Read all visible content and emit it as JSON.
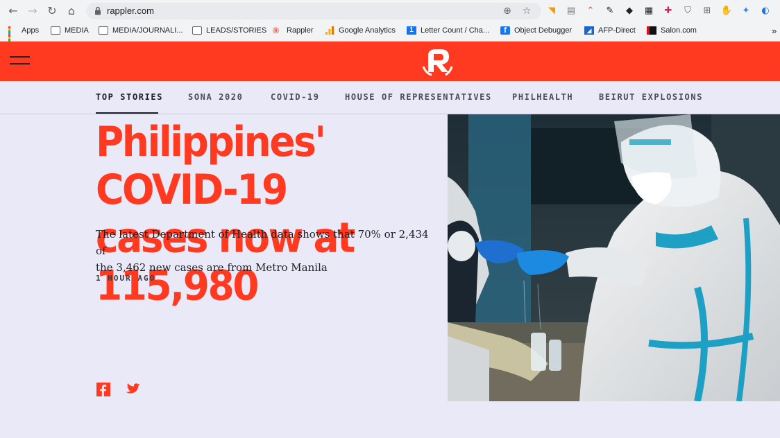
{
  "browser": {
    "url": "rappler.com",
    "bookmarks": [
      {
        "label": "Apps",
        "icon": "apps-grid-icon"
      },
      {
        "label": "MEDIA",
        "icon": "folder-icon"
      },
      {
        "label": "MEDIA/JOURNALI...",
        "icon": "folder-icon"
      },
      {
        "label": "LEADS/STORIES",
        "icon": "folder-icon"
      },
      {
        "label": "Rappler",
        "icon": "rappler-favicon-icon"
      },
      {
        "label": "Google Analytics",
        "icon": "google-analytics-icon"
      },
      {
        "label": "Letter Count / Cha...",
        "icon": "letter-count-icon"
      },
      {
        "label": "Object Debugger",
        "icon": "facebook-icon"
      },
      {
        "label": "AFP-Direct",
        "icon": "afp-icon"
      },
      {
        "label": "Salon.com",
        "icon": "salon-icon"
      }
    ],
    "overflow": "»"
  },
  "site": {
    "brand_color": "#ff3a20",
    "background": "#e9e9f7"
  },
  "nav": {
    "tabs": [
      {
        "label": "TOP STORIES",
        "active": true
      },
      {
        "label": "SONA 2020",
        "active": false
      },
      {
        "label": "COVID-19",
        "active": false
      },
      {
        "label": "HOUSE OF REPRESENTATIVES",
        "active": false
      },
      {
        "label": "PHILHEALTH",
        "active": false
      },
      {
        "label": "BEIRUT EXPLOSIONS",
        "active": false
      }
    ]
  },
  "story": {
    "headline_line1": "Philippines' COVID-19",
    "headline_line2": "cases now at 115,980",
    "dek_line1": "The latest Department of Health data shows that 70% or 2,434 of",
    "dek_line2": "the 3,462 new cases are from Metro Manila",
    "timestamp": "1 HOUR AGO"
  }
}
